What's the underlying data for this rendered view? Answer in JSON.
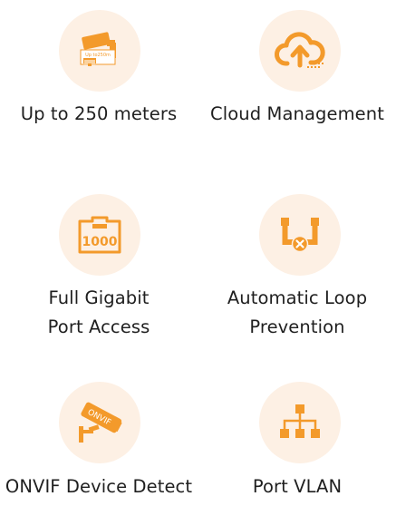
{
  "features": [
    {
      "icon": "cctv-camera-cable-icon",
      "badge": "Up to250m",
      "lines": [
        "Up to 250 meters"
      ]
    },
    {
      "icon": "cloud-upload-icon",
      "lines": [
        "Cloud Management"
      ]
    },
    {
      "icon": "ethernet-port-icon",
      "badge": "1000",
      "lines": [
        "Full Gigabit",
        "Port Access"
      ]
    },
    {
      "icon": "loop-prevention-icon",
      "lines": [
        "Automatic Loop",
        "Prevention"
      ]
    },
    {
      "icon": "onvif-camera-icon",
      "badge": "ONVIF",
      "lines": [
        "ONVIF Device Detect"
      ]
    },
    {
      "icon": "vlan-tree-icon",
      "lines": [
        "Port VLAN"
      ]
    }
  ],
  "colors": {
    "accent": "#f39a2b",
    "circle": "#fdf0e4",
    "text": "#1f1f1f"
  }
}
